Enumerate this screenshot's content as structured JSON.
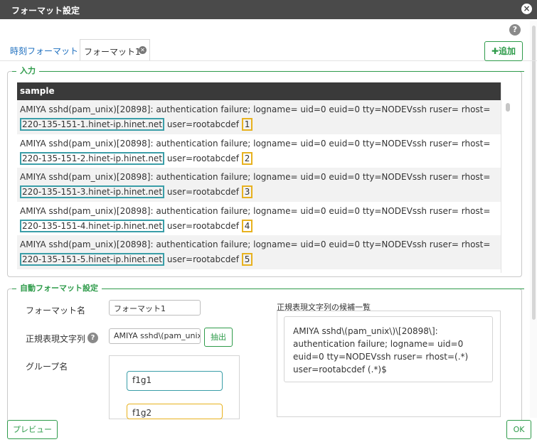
{
  "dialog": {
    "title": "フォーマット設定"
  },
  "tabs": [
    {
      "label": "時刻フォーマット"
    },
    {
      "label": "フォーマット1"
    }
  ],
  "toolbar": {
    "add_label": "追加"
  },
  "input_section": {
    "legend": "入力",
    "column_header": "sample",
    "rows": [
      {
        "prefix": "AMIYA sshd(pam_unix)[20898]: authentication failure; logname= uid=0 euid=0 tty=NODEVssh ruser= rhost=",
        "host": "220-135-151-1.hinet-ip.hinet.net",
        "user": "user=rootabcdef",
        "num": "1"
      },
      {
        "prefix": "AMIYA sshd(pam_unix)[20898]: authentication failure; logname= uid=0 euid=0 tty=NODEVssh ruser= rhost=",
        "host": "220-135-151-2.hinet-ip.hinet.net",
        "user": "user=rootabcdef",
        "num": "2"
      },
      {
        "prefix": "AMIYA sshd(pam_unix)[20898]: authentication failure; logname= uid=0 euid=0 tty=NODEVssh ruser= rhost=",
        "host": "220-135-151-3.hinet-ip.hinet.net",
        "user": "user=rootabcdef",
        "num": "3"
      },
      {
        "prefix": "AMIYA sshd(pam_unix)[20898]: authentication failure; logname= uid=0 euid=0 tty=NODEVssh ruser= rhost=",
        "host": "220-135-151-4.hinet-ip.hinet.net",
        "user": "user=rootabcdef",
        "num": "4"
      },
      {
        "prefix": "AMIYA sshd(pam_unix)[20898]: authentication failure; logname= uid=0 euid=0 tty=NODEVssh ruser= rhost=",
        "host": "220-135-151-5.hinet-ip.hinet.net",
        "user": "user=rootabcdef",
        "num": "5"
      }
    ]
  },
  "auto_format": {
    "legend": "自動フォーマット設定",
    "format_name_label": "フォーマット名",
    "format_name_value": "フォーマット1",
    "regex_label": "正規表現文字列",
    "regex_value": "AMIYA sshd\\(pam_unix\\)\\[20898\\]: authentication failure; logname= uid=0 euid=0 tty=NODEVssh ruser= rhost=(.*) user=rootabcdef (.*)$",
    "extract_label": "抽出",
    "group_label": "グループ名",
    "groups": [
      "f1g1",
      "f1g2"
    ],
    "candidates_label": "正規表現文字列の候補一覧",
    "candidate": "AMIYA sshd\\(pam_unix\\)\\[20898\\]: authentication failure; logname= uid=0 euid=0 tty=NODEVssh ruser= rhost=(.*) user=rootabcdef (.*)$"
  },
  "footer": {
    "preview_label": "プレビュー",
    "ok_label": "OK"
  },
  "colors": {
    "accent": "#2e9b4a",
    "host_highlight": "#3a9ea8",
    "num_highlight": "#e8b21f",
    "titlebar": "#4a4a4a"
  }
}
